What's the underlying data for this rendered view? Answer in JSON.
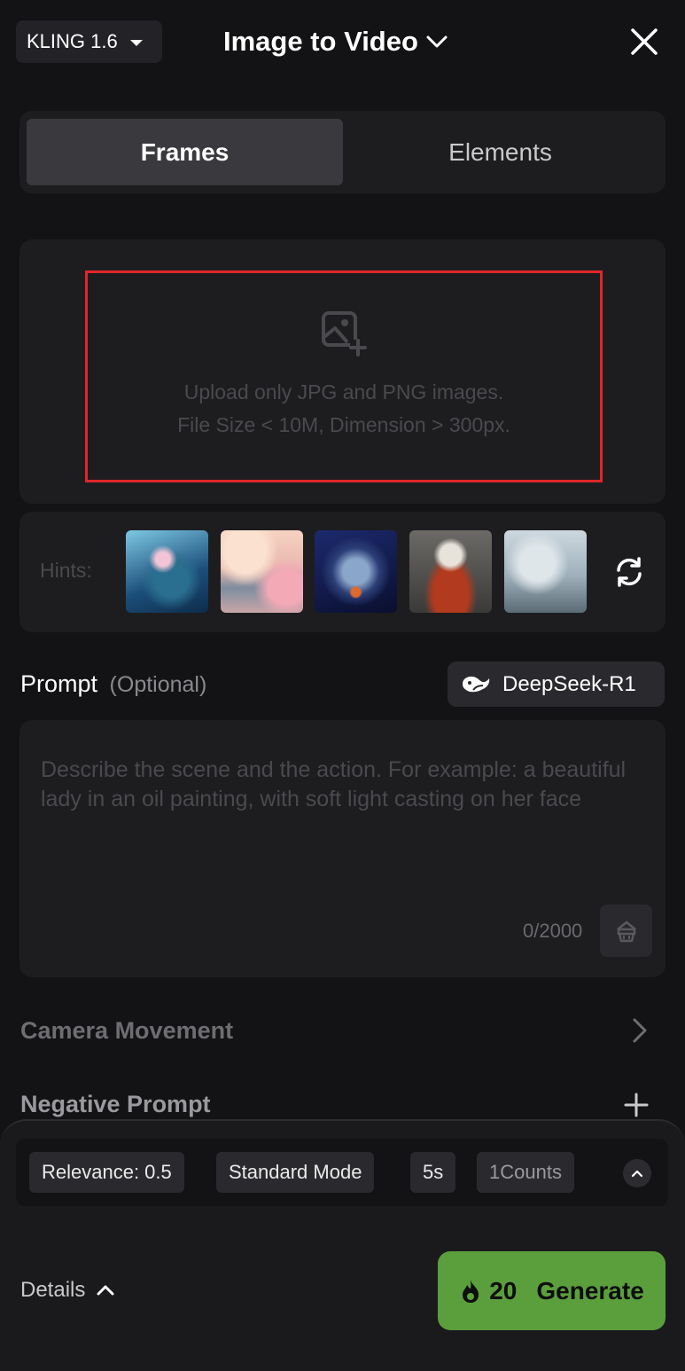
{
  "header": {
    "model_label": "KLING 1.6",
    "title": "Image to Video"
  },
  "tabs": [
    {
      "label": "Frames",
      "active": true
    },
    {
      "label": "Elements",
      "active": false
    }
  ],
  "upload": {
    "line1": "Upload only JPG and PNG images.",
    "line2": "File Size < 10M, Dimension > 300px."
  },
  "hints": {
    "label": "Hints:",
    "thumbnails": [
      "anime-girl-underwater",
      "pastel-street-clouds",
      "astronaut-space",
      "cat-in-jacket",
      "snow-dragon-landscape"
    ]
  },
  "prompt": {
    "label": "Prompt",
    "optional": "(Optional)",
    "ai_button": "DeepSeek-R1",
    "placeholder": "Describe the scene and the action. For example: a beautiful lady in an oil painting, with soft light casting on her face",
    "char_count": "0/2000"
  },
  "sections": {
    "camera_movement": "Camera Movement",
    "negative_prompt": "Negative Prompt"
  },
  "options": {
    "relevance": "Relevance: 0.5",
    "mode": "Standard Mode",
    "duration": "5s",
    "counts": "1Counts"
  },
  "footer": {
    "details": "Details",
    "cost": "20",
    "generate": "Generate"
  },
  "colors": {
    "accent_green": "#5b9f3d",
    "highlight_red": "#e0262a"
  }
}
